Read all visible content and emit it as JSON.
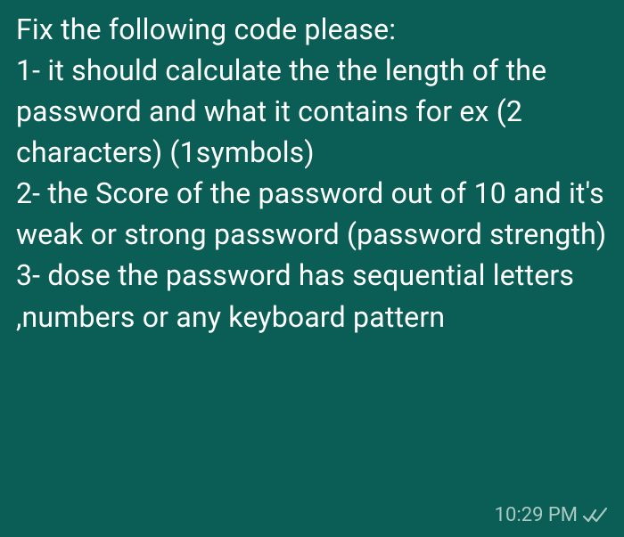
{
  "message": {
    "text": "Fix the following code please:\n1- it should calculate the the length of the password and what it contains for ex (2 characters) (1symbols)\n2- the Score of the password out of 10 and it's weak or strong password (password strength)\n3- dose the password has sequential letters ,numbers or any keyboard pattern",
    "timestamp": "10:29 PM",
    "status": "delivered"
  }
}
